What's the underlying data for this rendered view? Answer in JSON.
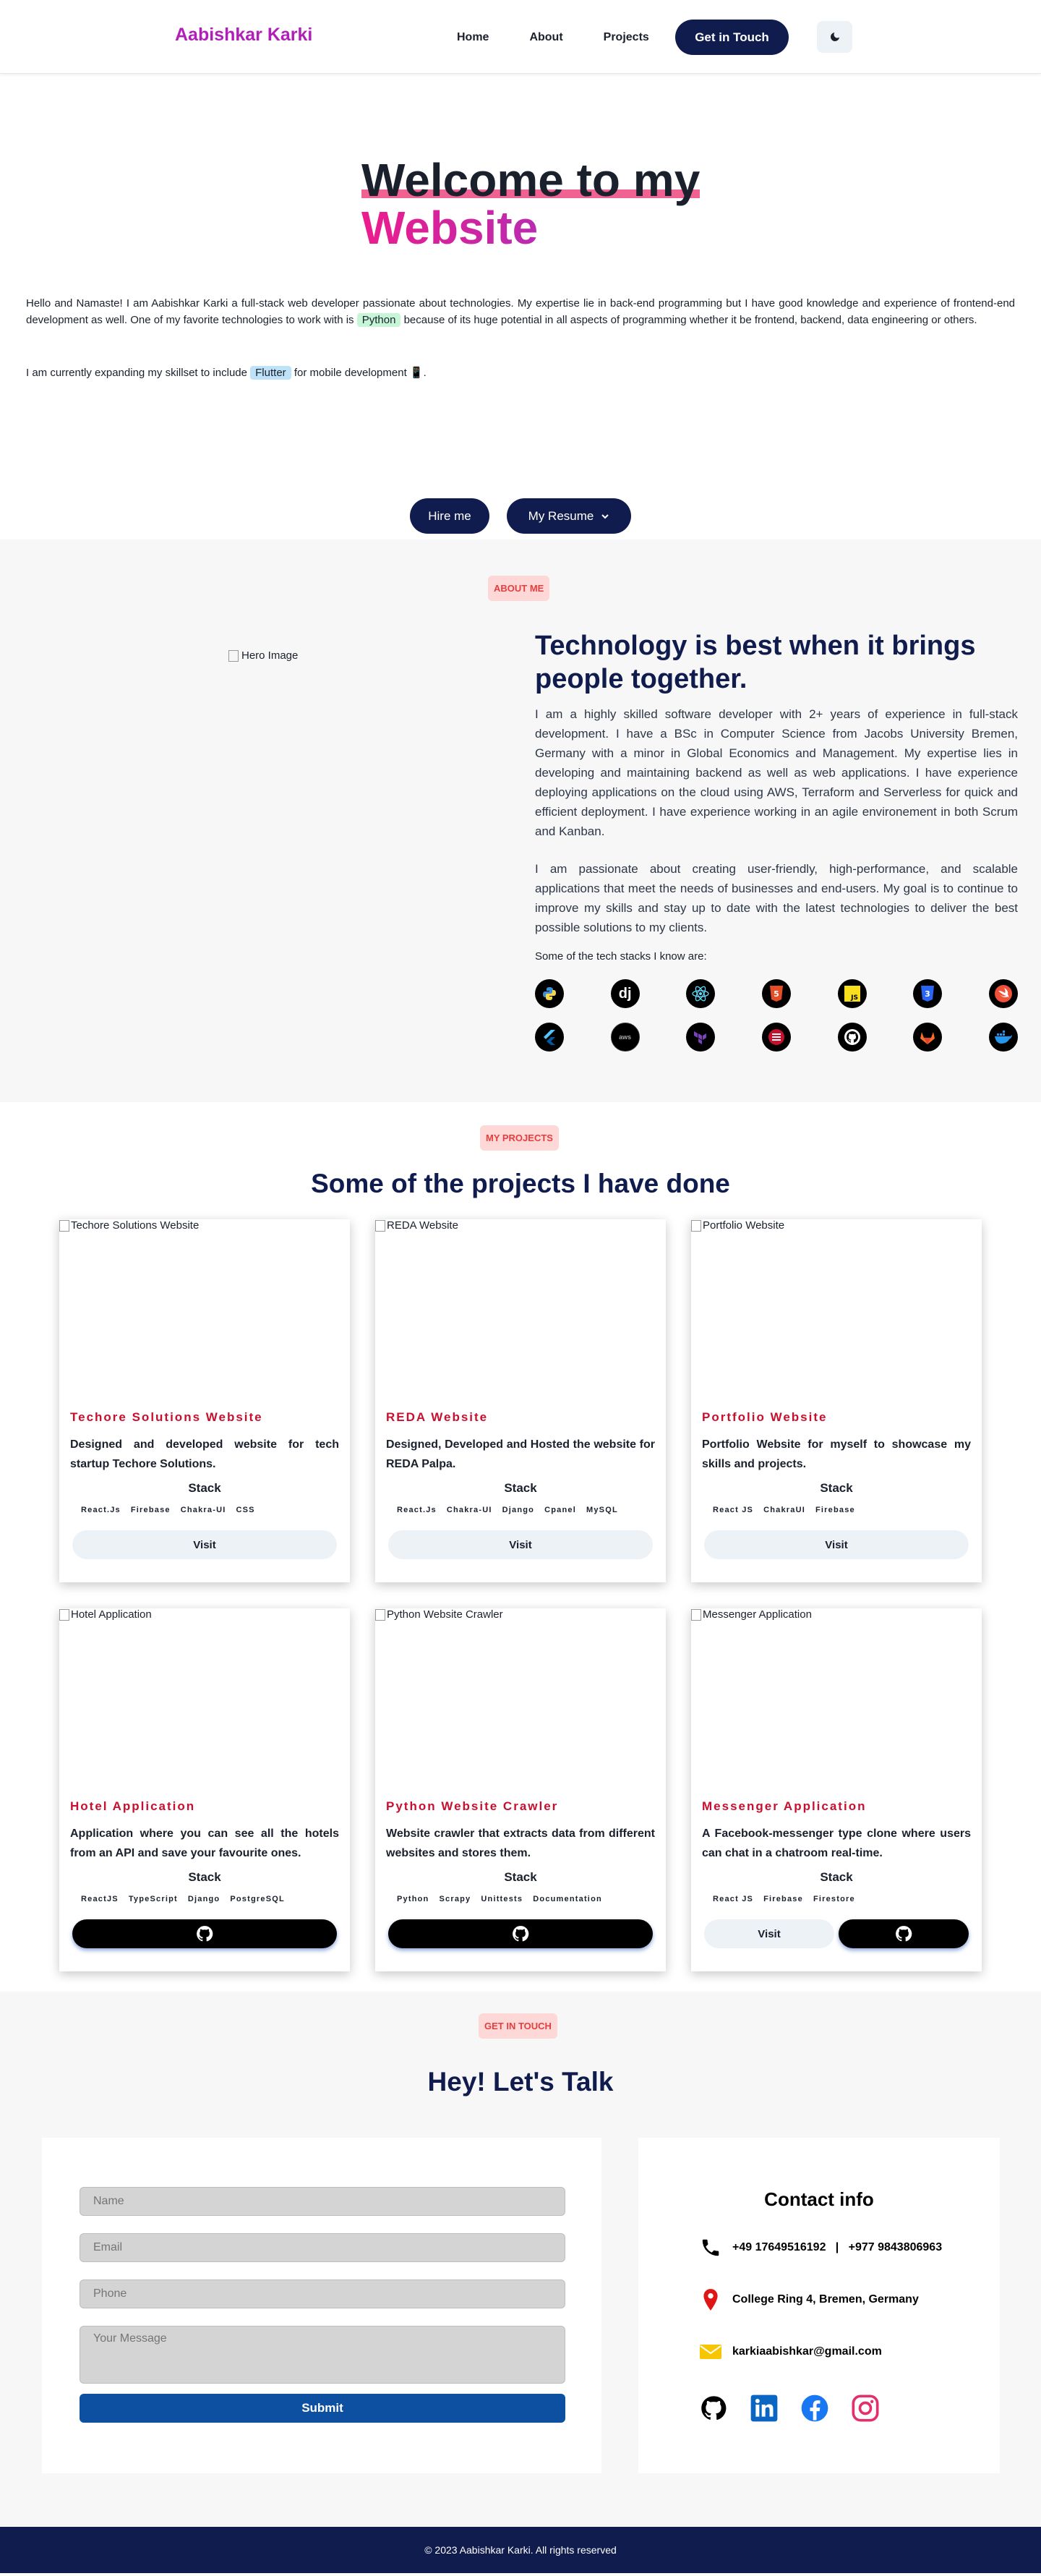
{
  "nav": {
    "brand": "Aabishkar Karki",
    "links": [
      "Home",
      "About",
      "Projects"
    ],
    "cta": "Get in Touch",
    "theme_icon": "moon-icon"
  },
  "hero": {
    "title_line1": "Welcome to my",
    "title_line2": "Website",
    "p1_before": "Hello and Namaste! I am Aabishkar Karki a full-stack web developer passionate about technologies. My expertise lie in back-end programming but I have good knowledge and experience of frontend-end development as well. One of my favorite technologies to work with is ",
    "p1_chip": "Python",
    "p1_after": " because of its huge potential in all aspects of programming whether it be frontend, backend, data engineering or others.",
    "p2_before": "I am currently expanding my skillset to include ",
    "p2_chip": "Flutter",
    "p2_after": " for mobile development 📱.",
    "btn_hire": "Hire me",
    "btn_resume": "My Resume"
  },
  "about": {
    "pill": "ABOUT ME",
    "img_alt": "Hero Image",
    "heading": "Technology is best when it brings people together.",
    "p1": "I am a highly skilled software developer with 2+ years of experience in full-stack development. I have a BSc in Computer Science from Jacobs University Bremen, Germany with a minor in Global Economics and Management. My expertise lies in developing and maintaining backend as well as web applications. I have experience deploying applications on the cloud using AWS, Terraform and Serverless for quick and efficient deployment. I have experience working in an agile environement in both Scrum and Kanban.",
    "p2": "I am passionate about creating user-friendly, high-performance, and scalable applications that meet the needs of businesses and end-users. My goal is to continue to improve my skills and stay up to date with the latest technologies to deliver the best possible solutions to my clients.",
    "stack_label": "Some of the tech stacks I know are:",
    "tech_row1": [
      "python-icon",
      "django-icon",
      "react-icon",
      "html5-icon",
      "javascript-icon",
      "css3-icon",
      "swift-icon"
    ],
    "tech_row2": [
      "flutter-icon",
      "aws-icon",
      "terraform-icon",
      "scrum-icon",
      "github-icon",
      "gitlab-icon",
      "docker-icon"
    ]
  },
  "projects": {
    "pill": "MY PROJECTS",
    "title": "Some of the projects I have done",
    "stack_heading": "Stack",
    "visit_label": "Visit",
    "items": [
      {
        "alt": "Techore Solutions Website",
        "name": "Techore Solutions Website",
        "desc": "Designed and developed website for tech startup Techore Solutions.",
        "tags": [
          "React.Js",
          "Firebase",
          "Chakra-UI",
          "CSS"
        ]
      },
      {
        "alt": "REDA Website",
        "name": "REDA Website",
        "desc": "Designed, Developed and Hosted the website for REDA Palpa.",
        "tags": [
          "React.Js",
          "Chakra-UI",
          "Django",
          "Cpanel",
          "MySQL"
        ]
      },
      {
        "alt": "Portfolio Website",
        "name": "Portfolio Website",
        "desc": "Portfolio Website for myself to showcase my skills and projects.",
        "tags": [
          "React JS",
          "ChakraUI",
          "Firebase"
        ]
      },
      {
        "alt": "Hotel Application",
        "name": "Hotel Application",
        "desc": "Application where you can see all the hotels from an API and save your favourite ones.",
        "tags": [
          "ReactJS",
          "TypeScript",
          "Django",
          "PostgreSQL"
        ]
      },
      {
        "alt": "Python Website Crawler",
        "name": "Python Website Crawler",
        "desc": "Website crawler that extracts data from different websites and stores them.",
        "tags": [
          "Python",
          "Scrapy",
          "Unittests",
          "Documentation"
        ]
      },
      {
        "alt": "Messenger Application",
        "name": "Messenger Application",
        "desc": "A Facebook-messenger type clone where users can chat in a chatroom real-time.",
        "tags": [
          "React JS",
          "Firebase",
          "Firestore"
        ]
      }
    ]
  },
  "contact": {
    "pill": "GET IN TOUCH",
    "title": "Hey! Let's Talk",
    "placeholders": {
      "name": "Name",
      "email": "Email",
      "phone": "Phone",
      "message": "Your Message"
    },
    "submit": "Submit",
    "info_title": "Contact info",
    "phone": "+49 17649516192   |   +977 9843806963",
    "address": "College Ring 4, Bremen, Germany",
    "email": "karkiaabishkar@gmail.com",
    "socials": [
      "github-icon",
      "linkedin-icon",
      "facebook-icon",
      "instagram-icon"
    ]
  },
  "footer": {
    "text": "© 2023 Aabishkar Karki. All rights reserved"
  }
}
